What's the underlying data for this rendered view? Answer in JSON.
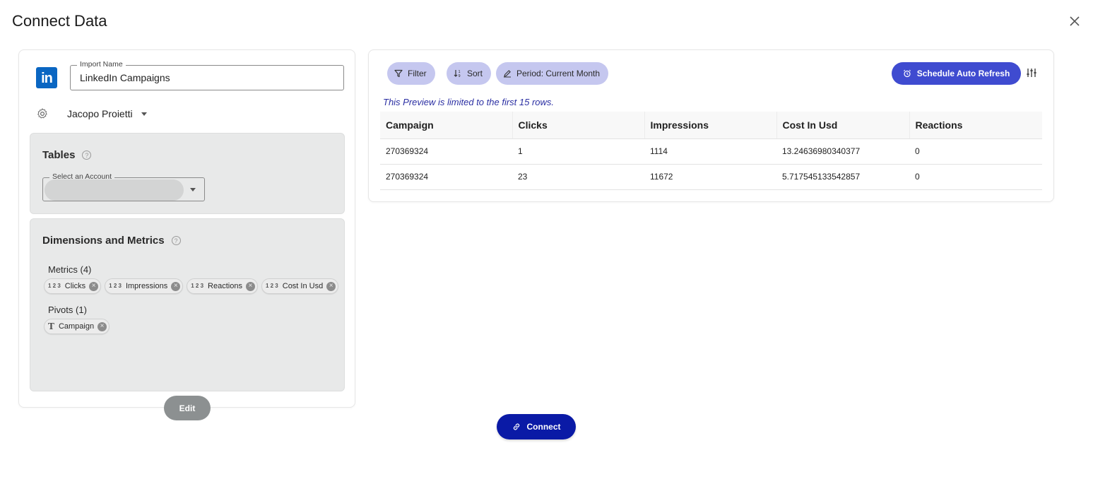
{
  "page": {
    "title": "Connect Data"
  },
  "source": {
    "logo_text": "in",
    "brand_color": "#0a66c2",
    "import_name_label": "Import Name",
    "import_name_value": "LinkedIn Campaigns",
    "account_name": "Jacopo Proietti"
  },
  "tables": {
    "title": "Tables",
    "help": "?",
    "select_account_label": "Select an Account"
  },
  "dimensions": {
    "title": "Dimensions and Metrics",
    "help": "?",
    "metrics_label": "Metrics (4)",
    "metrics": [
      {
        "icon": "1 2 3",
        "label": "Clicks"
      },
      {
        "icon": "1 2 3",
        "label": "Impressions"
      },
      {
        "icon": "1 2 3",
        "label": "Reactions"
      },
      {
        "icon": "1 2 3",
        "label": "Cost In Usd"
      }
    ],
    "pivots_label": "Pivots (1)",
    "pivots": [
      {
        "icon": "T",
        "label": "Campaign"
      }
    ],
    "edit_label": "Edit"
  },
  "toolbar": {
    "filter_label": "Filter",
    "sort_label": "Sort",
    "period_label": "Period: Current Month",
    "schedule_label": "Schedule Auto Refresh",
    "accent_color": "#3f4bd0",
    "chip_color": "#c5c7ef"
  },
  "preview": {
    "note": "This Preview is limited to the first 15 rows.",
    "columns": [
      "Campaign",
      "Clicks",
      "Impressions",
      "Cost In Usd",
      "Reactions"
    ],
    "rows": [
      [
        "270369324",
        "1",
        "1114",
        "13.24636980340377",
        "0"
      ],
      [
        "270369324",
        "23",
        "11672",
        "5.717545133542857",
        "0"
      ]
    ]
  },
  "footer": {
    "connect_label": "Connect",
    "connect_color": "#0a1aa6"
  }
}
